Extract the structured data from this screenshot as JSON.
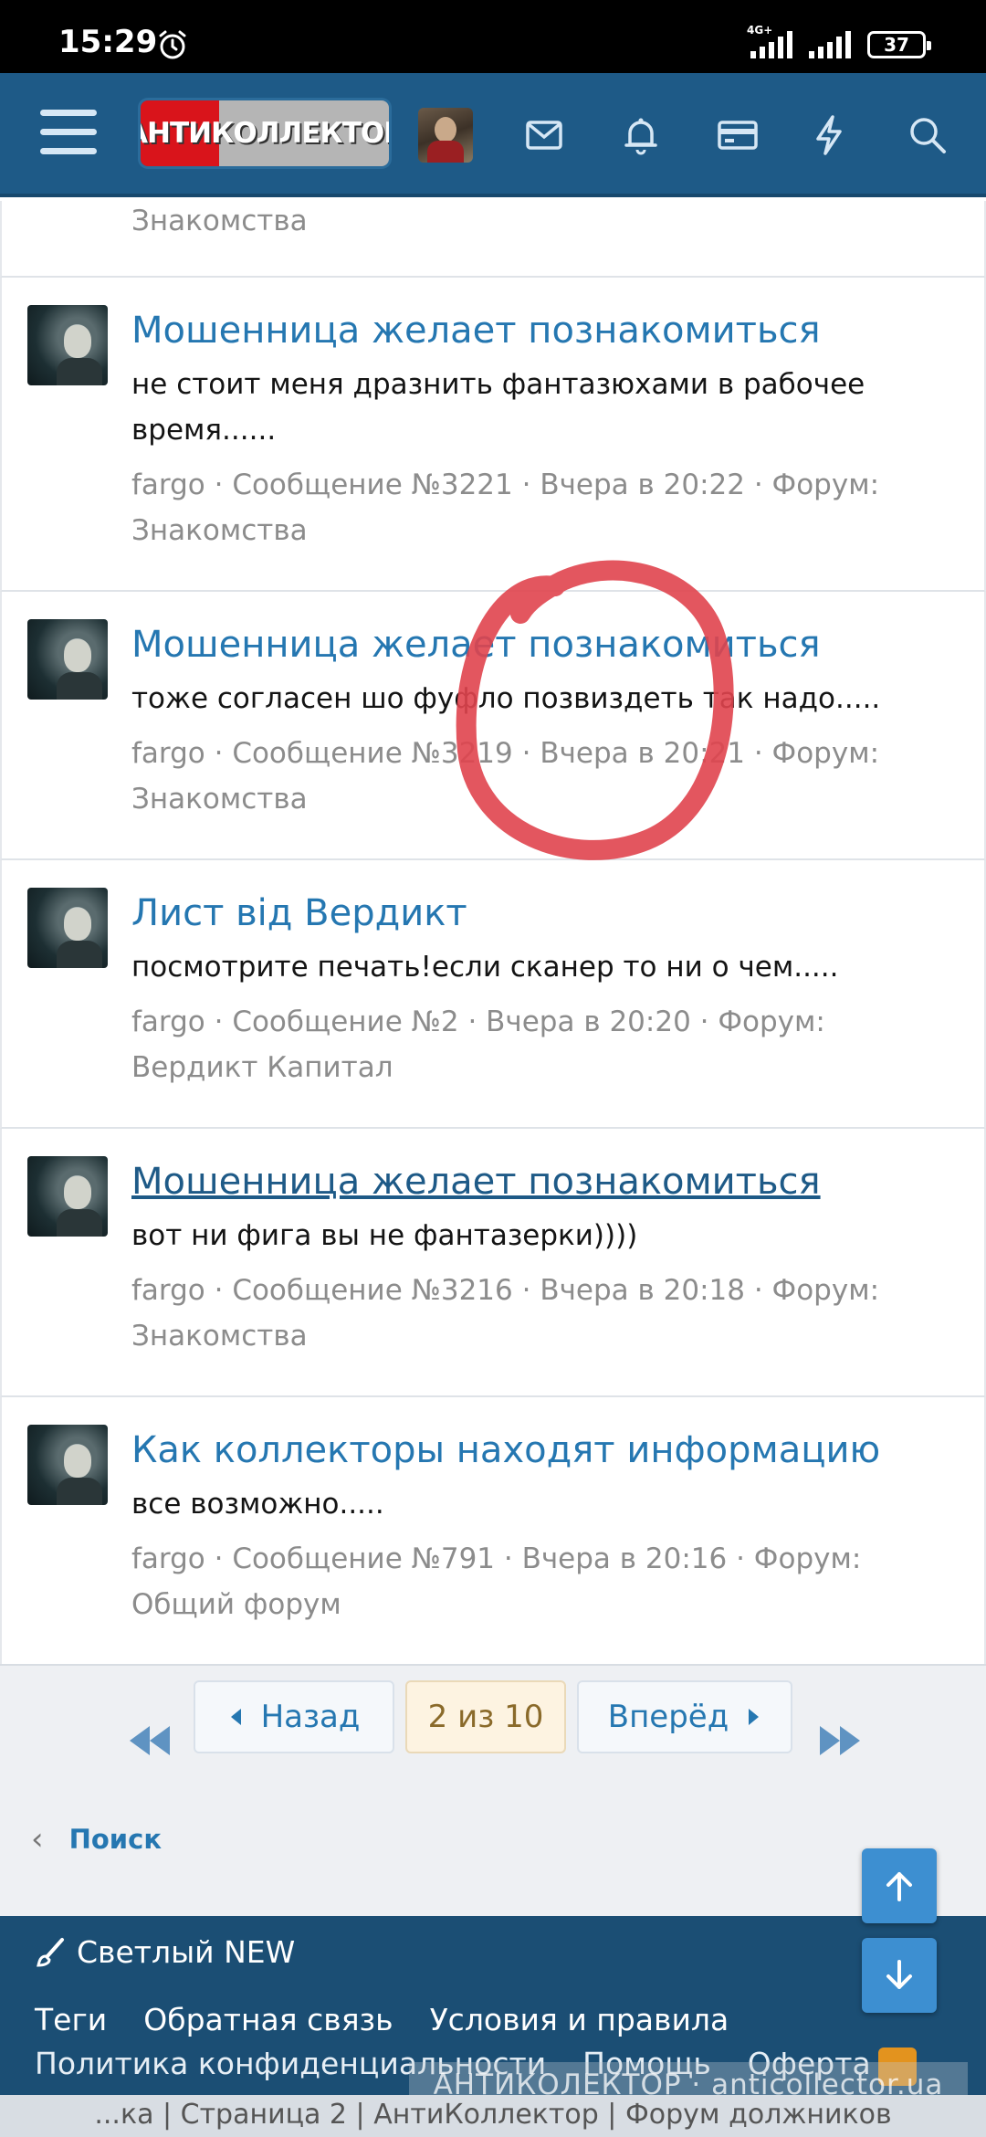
{
  "status_bar": {
    "time": "15:29",
    "network": "4G+",
    "battery": "37"
  },
  "header": {
    "logo_text": "АНТИКОЛЛЕКТОР"
  },
  "first_item": {
    "forum_tail": "Знакомства"
  },
  "results": [
    {
      "title": "Мошенница желает познакомиться",
      "snippet": "не стоит меня дразнить фантазюхами в рабочее время......",
      "meta_line1": "fargo · Сообщение №3221 · Вчера в 20:22 · Форум:",
      "meta_line2": "Знакомства"
    },
    {
      "title": "Мошенница желает познакомиться",
      "snippet": "тоже согласен шо фуфло позвиздеть так надо.....",
      "meta_line1": "fargo · Сообщение №3219 · Вчера в 20:21 · Форум:",
      "meta_line2": "Знакомства"
    },
    {
      "title": "Лист від Вердикт",
      "snippet": "посмотрите печать!если сканер то ни о чем.....",
      "meta_line1": "fargo · Сообщение №2 · Вчера в 20:20 · Форум:",
      "meta_line2": "Вердикт Капитал"
    },
    {
      "title": "Мошенница желает познакомиться",
      "snippet": "вот ни фига вы не фантазерки))))",
      "meta_line1": "fargo · Сообщение №3216 · Вчера в 20:18 · Форум:",
      "meta_line2": "Знакомства"
    },
    {
      "title": "Как коллекторы находят информацию",
      "snippet": "все возможно.....",
      "meta_line1": "fargo · Сообщение №791 · Вчера в 20:16 · Форум:",
      "meta_line2": "Общий форум"
    }
  ],
  "pagination": {
    "prev_label": "Назад",
    "current": "2 из 10",
    "next_label": "Вперёд"
  },
  "breadcrumb_link": "Поиск",
  "footer": {
    "style_label": "Светлый NEW",
    "links_row1": [
      "Теги",
      "Обратная связь",
      "Условия и правила"
    ],
    "links_row2": [
      "Политика конфиденциальности",
      "Помощь",
      "Оферта"
    ],
    "watermark": "АНТИКОЛЕКТОР · anticollector.ua"
  },
  "page_title_bar": "...ка | Страница 2 | АнтиКоллектор | Форум должников",
  "colors": {
    "header_bg": "#1e5a87",
    "link": "#2577b1",
    "annotation_circle": "#e0444e",
    "footer_bg": "#1b4e74"
  }
}
